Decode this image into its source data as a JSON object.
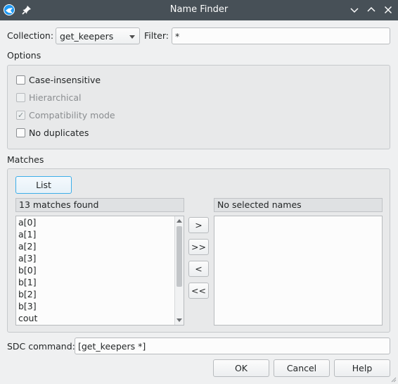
{
  "window": {
    "title": "Name Finder",
    "icons": [
      "app-logo-icon",
      "pin-icon",
      "minimize-icon",
      "maximize-icon",
      "close-icon"
    ]
  },
  "collection": {
    "label": "Collection:",
    "value": "get_keepers"
  },
  "filter": {
    "label": "Filter:",
    "value": "*"
  },
  "options": {
    "title": "Options",
    "items": [
      {
        "label": "Case-insensitive",
        "checked": false,
        "enabled": true
      },
      {
        "label": "Hierarchical",
        "checked": false,
        "enabled": false
      },
      {
        "label": "Compatibility mode",
        "checked": true,
        "enabled": false
      },
      {
        "label": "No duplicates",
        "checked": false,
        "enabled": true
      }
    ]
  },
  "matches": {
    "title": "Matches",
    "list_button": "List",
    "found_label": "13 matches found",
    "selected_label": "No selected names",
    "items": [
      "a[0]",
      "a[1]",
      "a[2]",
      "a[3]",
      "b[0]",
      "b[1]",
      "b[2]",
      "b[3]",
      "cout"
    ],
    "move_buttons": [
      ">",
      ">>",
      "<",
      "<<"
    ]
  },
  "sdc": {
    "label": "SDC command:",
    "value": "[get_keepers *]"
  },
  "buttons": {
    "ok": "OK",
    "cancel": "Cancel",
    "help": "Help"
  }
}
